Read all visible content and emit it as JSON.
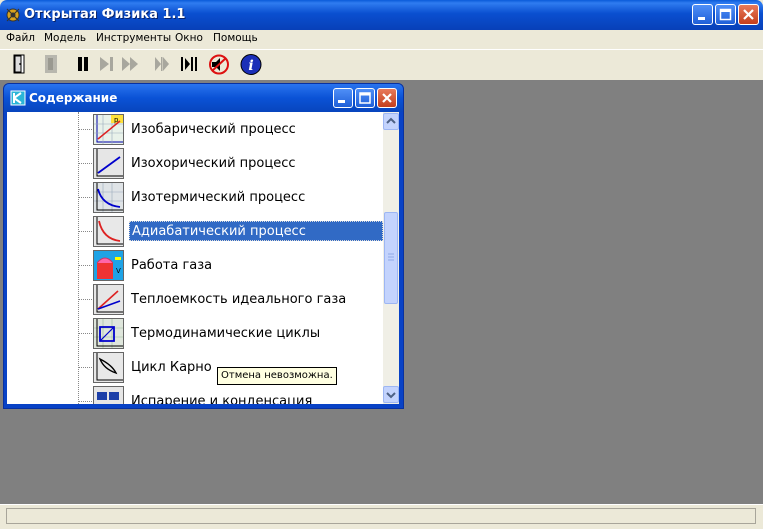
{
  "app": {
    "title": "Открытая Физика 1.1"
  },
  "menu": [
    "Файл",
    "Модель",
    "Инструменты",
    "Окно",
    "Помощь"
  ],
  "toolbar": {
    "buttons": [
      "exit",
      "model-disabled",
      "pause",
      "step",
      "fast-forward",
      "step-back-disabled",
      "step-bars",
      "mute",
      "info"
    ]
  },
  "contents_window": {
    "title": "Содержание",
    "items": [
      {
        "label": "Изобарический процесс",
        "icon": "isobaric-icon"
      },
      {
        "label": "Изохорический процесс",
        "icon": "isochoric-icon"
      },
      {
        "label": "Изотермический процесс",
        "icon": "isothermal-icon"
      },
      {
        "label": "Адиабатический процесс",
        "icon": "adiabatic-icon",
        "selected": true
      },
      {
        "label": "Работа газа",
        "icon": "gas-work-icon"
      },
      {
        "label": "Теплоемкость идеального газа",
        "icon": "heat-capacity-icon"
      },
      {
        "label": "Термодинамические циклы",
        "icon": "thermo-cycles-icon"
      },
      {
        "label": "Цикл Карно",
        "icon": "carnot-icon"
      },
      {
        "label": "Испарение и конденсация",
        "icon": "evaporation-icon"
      }
    ]
  },
  "tooltip": "Отмена невозможна.",
  "colors": {
    "title_blue": "#0a52d6",
    "selection": "#316ac5",
    "workspace": "#808080"
  }
}
